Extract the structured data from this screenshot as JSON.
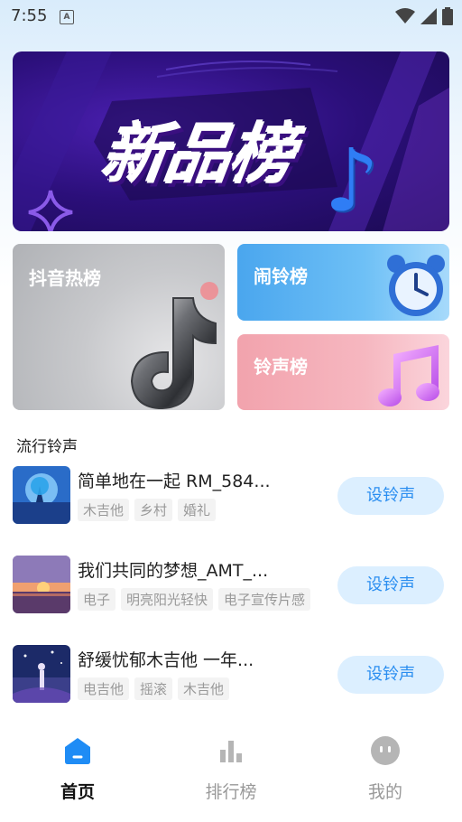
{
  "status_bar": {
    "time": "7:55",
    "notification_icon": "a-icon",
    "icons": [
      "wifi-icon",
      "signal-icon",
      "battery-icon"
    ]
  },
  "banner": {
    "title": "新品榜",
    "active_dot": 3,
    "dot_count": 3
  },
  "categories": {
    "douyin": "抖音热榜",
    "alarm": "闹铃榜",
    "ringtone": "铃声榜"
  },
  "section_title": "流行铃声",
  "songs": [
    {
      "title": "简单地在一起 RM_584...",
      "tags": [
        "木吉他",
        "乡村",
        "婚礼"
      ],
      "button": "设铃声"
    },
    {
      "title": "我们共同的梦想_AMT_...",
      "tags": [
        "电子",
        "明亮阳光轻快",
        "电子宣传片感"
      ],
      "button": "设铃声"
    },
    {
      "title": "舒缓忧郁木吉他 一年...",
      "tags": [
        "电吉他",
        "摇滚",
        "木吉他"
      ],
      "button": "设铃声"
    }
  ],
  "tabbar": {
    "home": "首页",
    "charts": "排行榜",
    "mine": "我的",
    "active": "home"
  },
  "colors": {
    "accent": "#2b8ef0",
    "button_bg": "#dcefff",
    "banner_bg": "#2b0f7a"
  }
}
